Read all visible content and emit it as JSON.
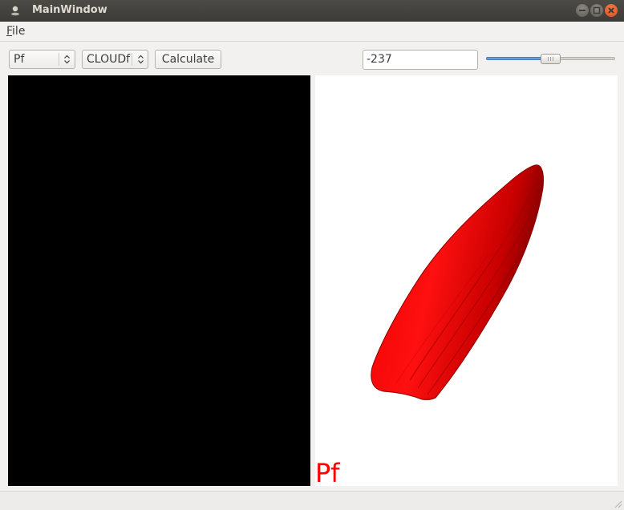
{
  "window": {
    "title": "MainWindow"
  },
  "menu": {
    "file_mnemonic": "F",
    "file_rest": "ile"
  },
  "toolbar": {
    "combo1_value": "Pf",
    "combo2_value": "CLOUDf",
    "calculate_label": "Calculate",
    "input_value": "-237",
    "slider_fraction": 0.5
  },
  "plot": {
    "label": "Pf",
    "color": "#ff0000"
  },
  "icons": [
    "app-icon",
    "minimize-icon",
    "maximize-icon",
    "close-icon",
    "updown-arrow-icon",
    "resize-grip-icon"
  ]
}
